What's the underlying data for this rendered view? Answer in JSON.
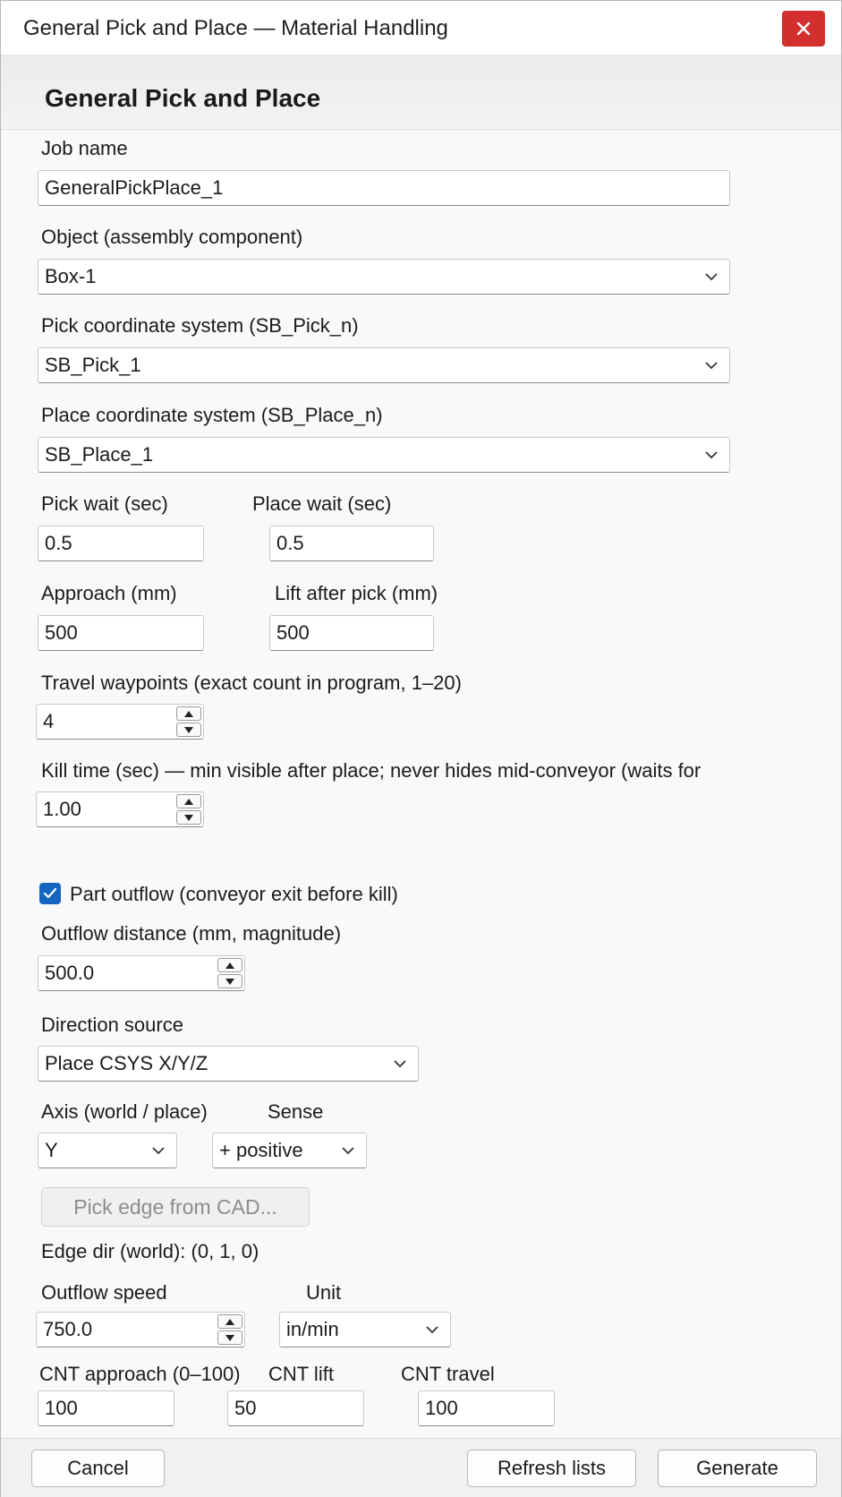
{
  "window": {
    "title": "General Pick and Place — Material Handling",
    "header_title": "General Pick and Place"
  },
  "form": {
    "job_name": {
      "label": "Job name",
      "value": "GeneralPickPlace_1"
    },
    "object": {
      "label": "Object (assembly component)",
      "value": "Box-1"
    },
    "pick_csys": {
      "label": "Pick coordinate system (SB_Pick_n)",
      "value": "SB_Pick_1"
    },
    "place_csys": {
      "label": "Place coordinate system (SB_Place_n)",
      "value": "SB_Place_1"
    },
    "pick_wait": {
      "label": "Pick wait (sec)",
      "value": "0.5"
    },
    "place_wait": {
      "label": "Place wait (sec)",
      "value": "0.5"
    },
    "approach": {
      "label": "Approach (mm)",
      "value": "500"
    },
    "lift_after_pick": {
      "label": "Lift after pick (mm)",
      "value": "500"
    },
    "travel_waypoints": {
      "label": "Travel waypoints (exact count in program, 1–20)",
      "value": "4"
    },
    "kill_time": {
      "label": "Kill time (sec) — min visible after place; never hides mid-conveyor (waits for",
      "value": "1.00"
    },
    "part_outflow": {
      "label": "Part outflow (conveyor exit before kill)",
      "checked": true
    },
    "outflow_distance": {
      "label": "Outflow distance (mm, magnitude)",
      "value": "500.0"
    },
    "direction_source": {
      "label": "Direction source",
      "value": "Place CSYS X/Y/Z"
    },
    "axis": {
      "label": "Axis (world / place)",
      "value": "Y"
    },
    "sense": {
      "label": "Sense",
      "value": "+ positive"
    },
    "pick_edge_button": "Pick edge from CAD...",
    "edge_dir": "Edge dir (world): (0, 1, 0)",
    "outflow_speed": {
      "label": "Outflow speed",
      "value": "750.0"
    },
    "unit": {
      "label": "Unit",
      "value": "in/min"
    },
    "cnt_approach": {
      "label": "CNT approach (0–100)",
      "value": "100"
    },
    "cnt_lift": {
      "label": "CNT lift",
      "value": "50"
    },
    "cnt_travel": {
      "label": "CNT travel",
      "value": "100"
    }
  },
  "footer": {
    "cancel": "Cancel",
    "refresh": "Refresh lists",
    "generate": "Generate"
  },
  "colors": {
    "close_button": "#d32f2f",
    "checkbox_accent": "#1565c0"
  },
  "icons": {
    "close": "close-icon",
    "dropdown": "chevron-down-icon",
    "spin_up": "spin-up-icon",
    "spin_down": "spin-down-icon",
    "check": "checkmark-icon"
  }
}
